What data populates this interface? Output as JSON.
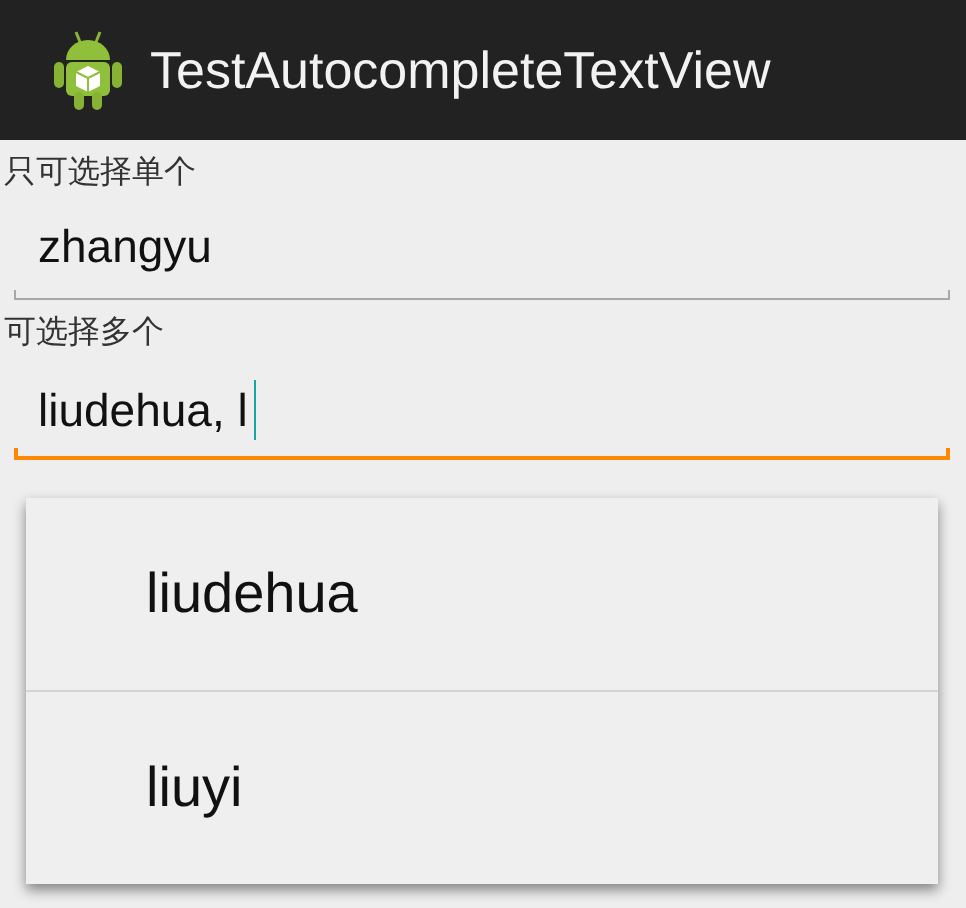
{
  "action_bar": {
    "title": "TestAutocompleteTextView"
  },
  "fields": [
    {
      "label": "只可选择单个",
      "value": "zhangyu",
      "focused": false
    },
    {
      "label": "可选择多个",
      "value": "liudehua, l",
      "focused": true
    }
  ],
  "suggestions": [
    {
      "text": "liudehua"
    },
    {
      "text": "liuyi"
    }
  ]
}
